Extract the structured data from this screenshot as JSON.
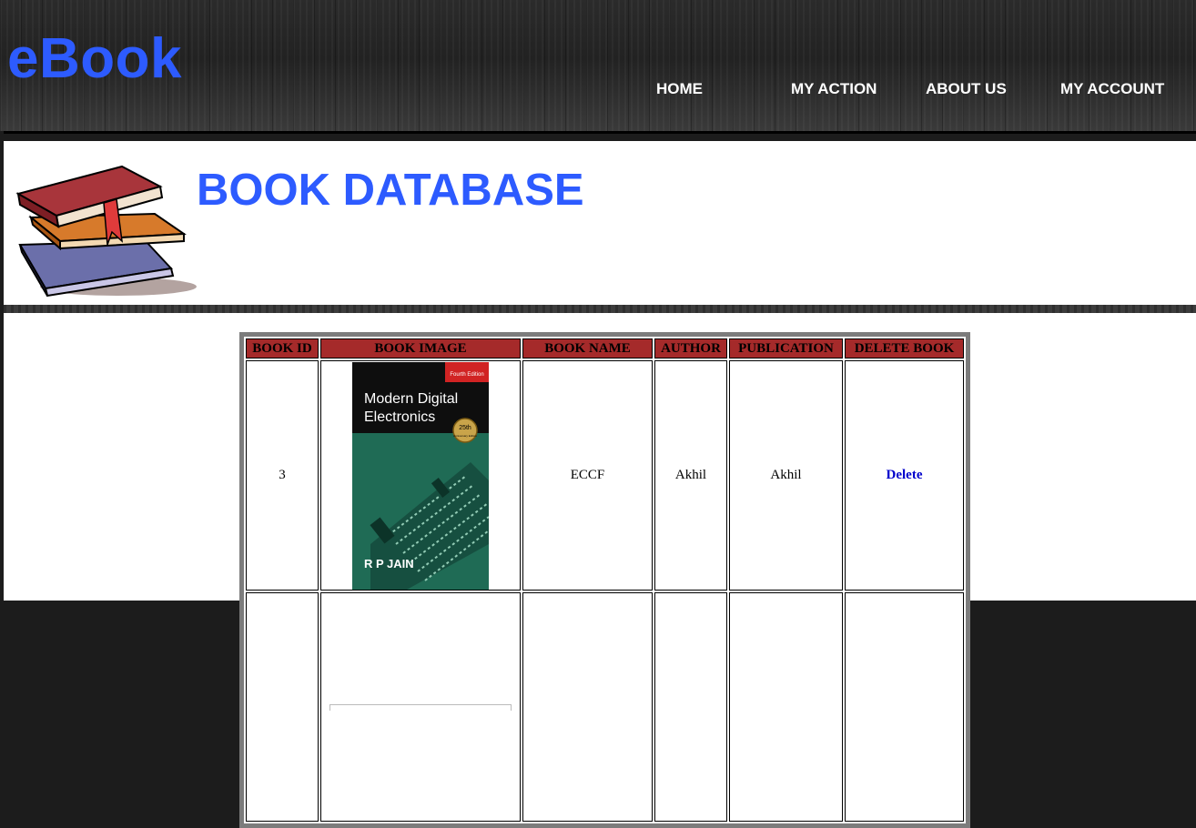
{
  "header": {
    "logo": "eBook",
    "nav": [
      {
        "label": "HOME"
      },
      {
        "label": "MY ACTION"
      },
      {
        "label": "ABOUT US"
      },
      {
        "label": "MY ACCOUNT"
      }
    ]
  },
  "banner": {
    "title": "BOOK DATABASE",
    "icon": "books-stack-icon"
  },
  "table": {
    "headers": [
      "BOOK ID",
      "BOOK IMAGE",
      "BOOK NAME",
      "AUTHOR",
      "PUBLICATION",
      "DELETE BOOK"
    ],
    "rows": [
      {
        "book_id": "3",
        "cover": {
          "title_line1": "Modern Digital",
          "title_line2": "Electronics",
          "edition": "Fourth Edition",
          "seal_top": "25th",
          "seal_bottom": "Anniversary Edition",
          "author": "R P JAIN"
        },
        "book_name": "ECCF",
        "author": "Akhil",
        "publication": "Akhil",
        "delete_label": "Delete"
      }
    ]
  },
  "colors": {
    "brand": "#2d5bff",
    "header_bg": "#a52a2a",
    "link": "#0000cc"
  }
}
